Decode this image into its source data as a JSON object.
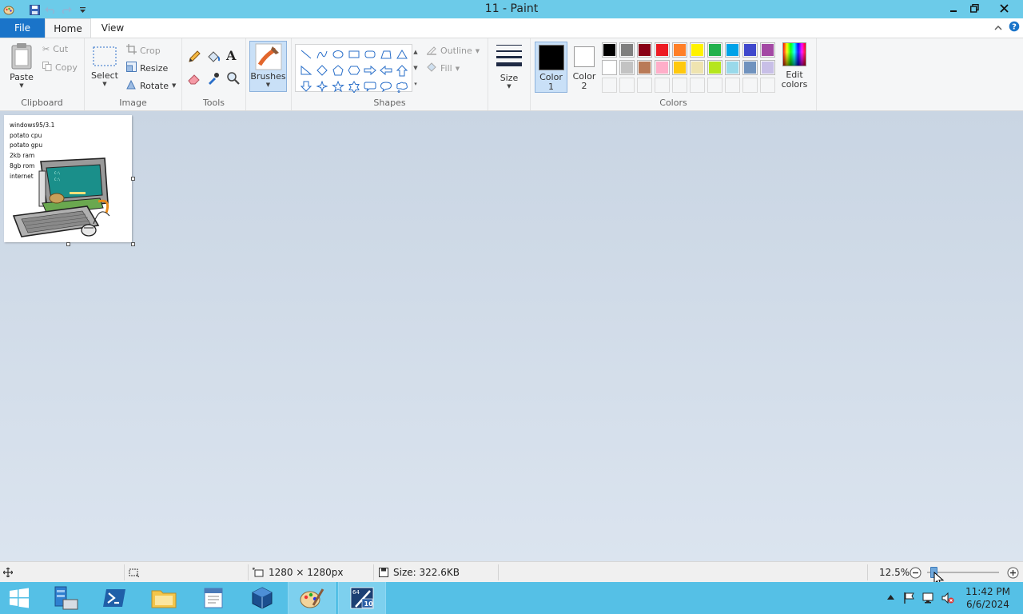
{
  "window": {
    "title": "11 - Paint",
    "controls": [
      "minimize-icon",
      "restore-icon",
      "close-icon"
    ]
  },
  "quick_access": [
    "paint-app-icon",
    "save-icon",
    "undo-icon",
    "redo-icon",
    "customize-dropdown-icon"
  ],
  "tabs": {
    "file": "File",
    "home": "Home",
    "view": "View"
  },
  "ribbon": {
    "clipboard": {
      "paste": "Paste",
      "cut": "Cut",
      "copy": "Copy",
      "label": "Clipboard"
    },
    "image": {
      "select": "Select",
      "crop": "Crop",
      "resize": "Resize",
      "rotate": "Rotate",
      "label": "Image"
    },
    "tools": {
      "label": "Tools",
      "items": [
        "pencil-icon",
        "fill-icon",
        "text-icon",
        "eraser-icon",
        "color-picker-icon",
        "magnifier-icon"
      ]
    },
    "brushes": {
      "label": "Brushes"
    },
    "shapes": {
      "label": "Shapes",
      "outline": "Outline",
      "fill": "Fill",
      "items": [
        "line",
        "curve",
        "oval",
        "rectangle",
        "rounded-rectangle",
        "polygon",
        "triangle",
        "right-triangle",
        "diamond",
        "pentagon",
        "hexagon",
        "right-arrow",
        "left-arrow",
        "up-arrow",
        "down-arrow",
        "four-point-star",
        "five-point-star",
        "six-point-star",
        "rounded-callout",
        "oval-callout",
        "cloud-callout"
      ]
    },
    "size": {
      "label": "Size"
    },
    "colors": {
      "color1_label1": "Color",
      "color1_label2": "1",
      "color1_value": "#000000",
      "color2_label1": "Color",
      "color2_label2": "2",
      "color2_value": "#ffffff",
      "label": "Colors",
      "edit_label1": "Edit",
      "edit_label2": "colors",
      "palette_row1": [
        "#000000",
        "#7f7f7f",
        "#880015",
        "#ed1c24",
        "#ff7f27",
        "#fff200",
        "#22b14c",
        "#00a2e8",
        "#3f48cc",
        "#a349a4"
      ],
      "palette_row2": [
        "#ffffff",
        "#c3c3c3",
        "#b97a57",
        "#ffaec9",
        "#ffc90e",
        "#efe4b0",
        "#b5e61d",
        "#99d9ea",
        "#7092be",
        "#c8bfe7"
      ]
    }
  },
  "canvas": {
    "text_lines": [
      "windows95/3.1",
      "potato cpu",
      "potato gpu",
      "2kb ram",
      "8gb rom",
      "internet"
    ]
  },
  "status": {
    "dimensions": "1280 × 1280px",
    "size": "Size: 322.6KB",
    "zoom": "12.5%"
  },
  "taskbar": {
    "apps": [
      "start-icon",
      "server-manager-icon",
      "powershell-icon",
      "file-explorer-icon",
      "wordpad-icon",
      "virtualbox-icon",
      "paint-icon",
      "windows10-app-icon"
    ],
    "time": "11:42 PM",
    "date": "6/6/2024"
  }
}
